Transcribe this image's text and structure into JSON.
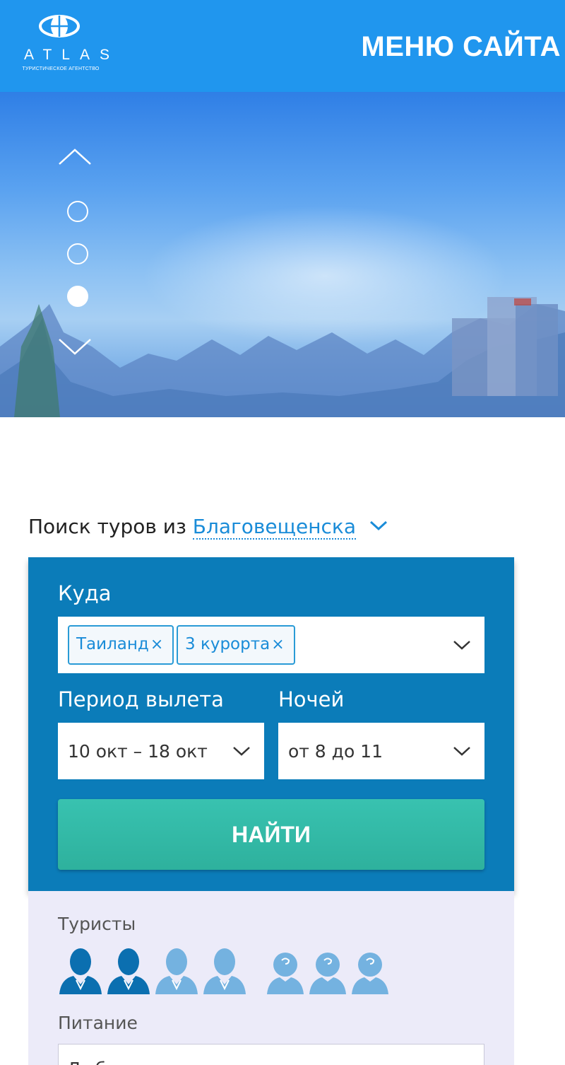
{
  "header": {
    "logo_text": "ATLAS",
    "logo_subtitle": "ТУРИСТИЧЕСКОЕ АГЕНТСТВО",
    "menu_title": "МЕНЮ САЙТА"
  },
  "hero": {
    "slides": 3,
    "active_slide": 3
  },
  "search": {
    "heading_prefix": "Поиск туров из",
    "city": "Благовещенска",
    "destination_label": "Куда",
    "destination_tags": [
      {
        "label": "Таиланд",
        "remove": "×"
      },
      {
        "label": "3 курорта",
        "remove": "×"
      }
    ],
    "period_label": "Период вылета",
    "period_value": "10 окт – 18 окт",
    "nights_label": "Ночей",
    "nights_value": "от 8 до 11",
    "find_button": "НАЙТИ",
    "tourists_label": "Туристы",
    "adults_selected": 2,
    "adults_total": 4,
    "children_total": 3,
    "meal_label": "Питание",
    "meal_value": "Любое"
  },
  "colors": {
    "header_bg": "#2096ee",
    "panel_bg": "#0b7cb9",
    "button_bg": "#33b9a6",
    "link": "#1a8cd8",
    "extra_bg": "#ecebf9",
    "person_active": "#0b6fb0",
    "person_inactive": "#74b2e0"
  },
  "icons": {
    "logo": "globe-logo-icon",
    "slider_up": "chevron-up-icon",
    "slider_down": "chevron-down-icon",
    "dropdown": "chevron-down-icon",
    "adult": "adult-person-icon",
    "child": "child-person-icon"
  }
}
